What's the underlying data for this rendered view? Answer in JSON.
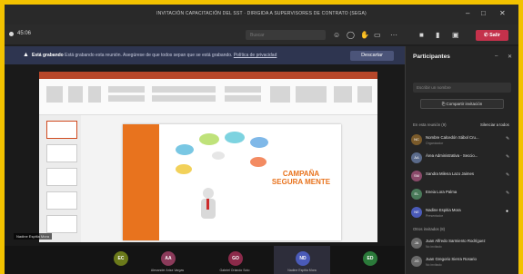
{
  "window": {
    "title": "INVITACIÓN CAPACITACIÓN DEL SST · DIRIGIDA A SUPERVISORES DE CONTRATO (SEGA)",
    "controls": [
      "–",
      "□",
      "✕"
    ]
  },
  "toolbar": {
    "timer": "45:06",
    "search_placeholder": "Buscar",
    "leave_label": "Salir",
    "accent": "#c4314b"
  },
  "banner": {
    "bold": "Está grabando",
    "message": "Está grabando esta reunión. Asegúrese de que todos sepan que se está grabando.",
    "link": "Política de privacidad",
    "dismiss": "Descartar"
  },
  "slide": {
    "title_line1": "CAMPAÑA",
    "title_line2": "SEGURA MENTE",
    "brand_color": "#e8731e"
  },
  "presenter_tag": "Nadine Espitia Mora",
  "bottom_participants": [
    {
      "initials": "EC",
      "color": "#6b7a1a",
      "label": "",
      "active": false
    },
    {
      "initials": "AA",
      "color": "#8b3a5a",
      "label": "Alexander Ariza Vargas",
      "active": false
    },
    {
      "initials": "GO",
      "color": "#8b2a4a",
      "label": "Gabriel Orlando Soto",
      "active": false
    },
    {
      "initials": "ND",
      "color": "#4a5ab8",
      "label": "Nadine Espitia Mora",
      "active": true
    },
    {
      "initials": "ED",
      "color": "#2b7a3a",
      "label": "",
      "active": false
    }
  ],
  "panel": {
    "title": "Participantes",
    "invite_placeholder": "Escribir un nombre",
    "share_label": "Compartir invitación",
    "in_meeting_header": "En esta reunión (9)",
    "mute_all": "Silenciar a todos",
    "others_header": "Otros invitados (8)",
    "people": [
      {
        "name": "Nombre Calcedón Sábol Cru...",
        "role": "Organizador",
        "initials": "NC",
        "color": "#7a5a2a",
        "mic": "✎"
      },
      {
        "name": "Área Administrativa - Seccio...",
        "role": "",
        "initials": "ÁA",
        "color": "#5a6a8a",
        "mic": "✎"
      },
      {
        "name": "Sandra Milena Lazo Jaimes",
        "role": "",
        "initials": "SM",
        "color": "#8a4a6a",
        "mic": "✎"
      },
      {
        "name": "Eneia Lora Palma",
        "role": "",
        "initials": "EL",
        "color": "#4a7a5a",
        "mic": "✎"
      },
      {
        "name": "Nadine Espitia Mora",
        "role": "Presentador",
        "initials": "NE",
        "color": "#4a5ab8",
        "mic": "●"
      },
      {
        "name": "Juan Alfredo Sarmiento Rodríguez",
        "role": "No invitado",
        "initials": "JA",
        "color": "#6a6a6a",
        "mic": ""
      },
      {
        "name": "Juan Gregorio Sierra Rosario",
        "role": "No invitado",
        "initials": "JG",
        "color": "#6a6a6a",
        "mic": ""
      }
    ]
  }
}
